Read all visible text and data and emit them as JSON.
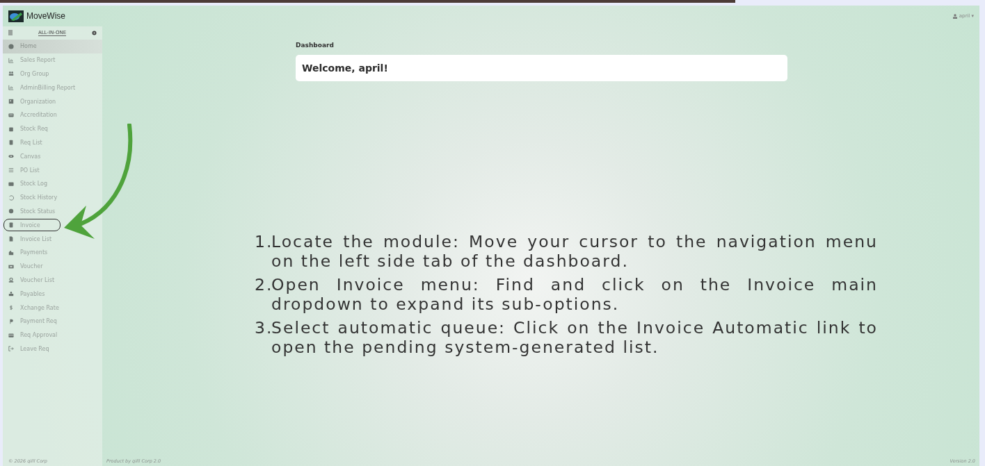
{
  "app": {
    "name": "MoveWise"
  },
  "user_menu": {
    "label": "april",
    "caret": "▾"
  },
  "sidebar": {
    "title": "ALL-IN-ONE",
    "items": [
      {
        "label": "Home",
        "selected": true,
        "circled": false
      },
      {
        "label": "Sales Report",
        "selected": false,
        "circled": false
      },
      {
        "label": "Org Group",
        "selected": false,
        "circled": false
      },
      {
        "label": "AdminBilling Report",
        "selected": false,
        "circled": false
      },
      {
        "label": "Organization",
        "selected": false,
        "circled": false
      },
      {
        "label": "Accreditation",
        "selected": false,
        "circled": false
      },
      {
        "label": "Stock Req",
        "selected": false,
        "circled": false
      },
      {
        "label": "Req List",
        "selected": false,
        "circled": false
      },
      {
        "label": "Canvas",
        "selected": false,
        "circled": false
      },
      {
        "label": "PO List",
        "selected": false,
        "circled": false
      },
      {
        "label": "Stock Log",
        "selected": false,
        "circled": false
      },
      {
        "label": "Stock History",
        "selected": false,
        "circled": false
      },
      {
        "label": "Stock Status",
        "selected": false,
        "circled": false
      },
      {
        "label": "Invoice",
        "selected": false,
        "circled": true
      },
      {
        "label": "Invoice List",
        "selected": false,
        "circled": false
      },
      {
        "label": "Payments",
        "selected": false,
        "circled": false
      },
      {
        "label": "Voucher",
        "selected": false,
        "circled": false
      },
      {
        "label": "Voucher List",
        "selected": false,
        "circled": false
      },
      {
        "label": "Payables",
        "selected": false,
        "circled": false
      },
      {
        "label": "Xchange Rate",
        "selected": false,
        "circled": false
      },
      {
        "label": "Payment Req",
        "selected": false,
        "circled": false
      },
      {
        "label": "Req Approval",
        "selected": false,
        "circled": false
      },
      {
        "label": "Leave Req",
        "selected": false,
        "circled": false
      }
    ]
  },
  "breadcrumb": "Dashboard",
  "welcome": "Welcome, april!",
  "steps": [
    {
      "number": "1.",
      "text": "Locate the module: Move your cursor to the navigation menu on the left side tab of the dashboard."
    },
    {
      "number": "2.",
      "text": "Open Invoice menu: Find and click on the Invoice main dropdown to expand its sub-options."
    },
    {
      "number": "3.",
      "text": "Select automatic queue: Click on the Invoice Automatic link to open the pending system-generated list."
    }
  ],
  "footer": {
    "copyright": "© 2026 qilll Corp",
    "product": "Product by qilll Corp 2.0",
    "version": "Version 2.0"
  }
}
